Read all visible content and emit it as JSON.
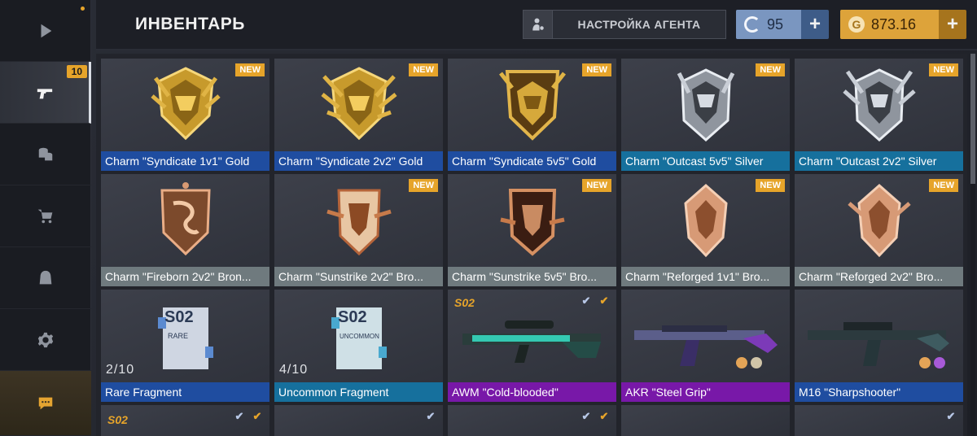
{
  "header": {
    "title": "ИНВЕНТАРЬ",
    "agent_button": "НАСТРОЙКА АГЕНТА",
    "credits": "95",
    "gold": "873.16",
    "plus": "+"
  },
  "sidebar": {
    "weapons_badge": "10",
    "icons": [
      "play-icon",
      "pistol-icon",
      "coins-icon",
      "cart-icon",
      "agent-icon",
      "gear-icon",
      "chat-icon"
    ]
  },
  "new_label": "NEW",
  "season_label": "S02",
  "items": [
    {
      "name": "Charm \"Syndicate 1v1\" Gold"
    },
    {
      "name": "Charm \"Syndicate 2v2\" Gold"
    },
    {
      "name": "Charm \"Syndicate 5v5\" Gold"
    },
    {
      "name": "Charm \"Outcast 5v5\" Silver"
    },
    {
      "name": "Charm \"Outcast 2v2\" Silver"
    },
    {
      "name": "Charm \"Fireborn 2v2\" Bron..."
    },
    {
      "name": "Charm \"Sunstrike 2v2\" Bro..."
    },
    {
      "name": "Charm \"Sunstrike 5v5\" Bro..."
    },
    {
      "name": "Charm \"Reforged 1v1\" Bro..."
    },
    {
      "name": "Charm \"Reforged 2v2\" Bro..."
    },
    {
      "name": "Rare Fragment",
      "count": "2/10",
      "label": "RARE"
    },
    {
      "name": "Uncommon Fragment",
      "count": "4/10",
      "label": "UNCOMMON"
    },
    {
      "name": "AWM \"Cold-blooded\""
    },
    {
      "name": "AKR \"Steel Grip\""
    },
    {
      "name": "M16 \"Sharpshooter\""
    }
  ],
  "colors": {
    "gold": "#e6a42a",
    "blue_rarity": "#1f4da0",
    "teal_rarity": "#16709d",
    "gray_rarity": "#6f7a7e",
    "purple_rarity": "#7818a8"
  }
}
